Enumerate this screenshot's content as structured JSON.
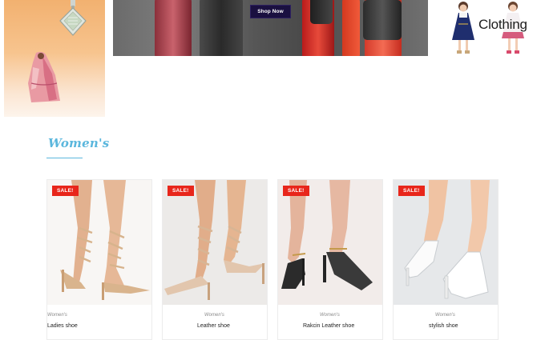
{
  "hero": {
    "shop_now_label": "Shop Now"
  },
  "promo_right": {
    "label": "Clothing"
  },
  "section": {
    "title": "Women's"
  },
  "products": [
    {
      "badge": "SALE!",
      "category": "Women's",
      "name": "Ladies shoe",
      "color": "#e7c4a3"
    },
    {
      "badge": "SALE!",
      "category": "Women's",
      "name": "Leather shoe",
      "color": "#e3c3a8"
    },
    {
      "badge": "SALE!",
      "category": "Women's",
      "name": "Rakcin Leather shoe",
      "color": "#2a2a2a"
    },
    {
      "badge": "SALE!",
      "category": "Women's",
      "name": "stylish shoe",
      "color": "#ffffff"
    }
  ],
  "colors": {
    "accent": "#5bb7dd",
    "sale": "#e8261b",
    "button": "#1a1040"
  }
}
